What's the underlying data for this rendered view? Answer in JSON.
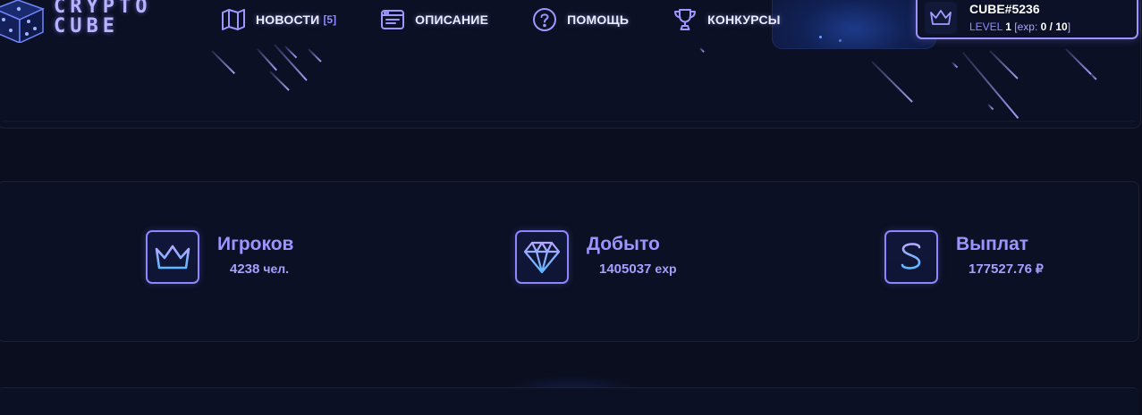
{
  "logo": {
    "line1": "CRYPTO",
    "line2": "CUBE"
  },
  "nav": {
    "items": [
      {
        "label": "НОВОСТИ",
        "badge": "[5]",
        "icon": "map-icon"
      },
      {
        "label": "ОПИСАНИЕ",
        "icon": "browser-window-icon"
      },
      {
        "label": "ПОМОЩЬ",
        "icon": "help-circle-icon"
      },
      {
        "label": "КОНКУРСЫ",
        "icon": "trophy-icon"
      }
    ]
  },
  "user": {
    "name": "CUBE#5236",
    "level_label": "LEVEL",
    "level": "1",
    "exp_open": "[exp: ",
    "exp": "0 / 10",
    "exp_close": "]",
    "icon": "crown-icon"
  },
  "stats": [
    {
      "title": "Игроков",
      "value": "4238",
      "unit": "чел.",
      "icon": "crown-icon"
    },
    {
      "title": "Добыто",
      "value": "1405037",
      "unit": "exp",
      "icon": "diamond-icon"
    },
    {
      "title": "Выплат",
      "value": "177527.76",
      "unit": "₽",
      "icon": "dollar-icon"
    }
  ],
  "colors": {
    "background": "#0a0e1f",
    "panel": "#0b1024",
    "accent": "#9c95ff",
    "nav_text": "#e9ecff"
  }
}
